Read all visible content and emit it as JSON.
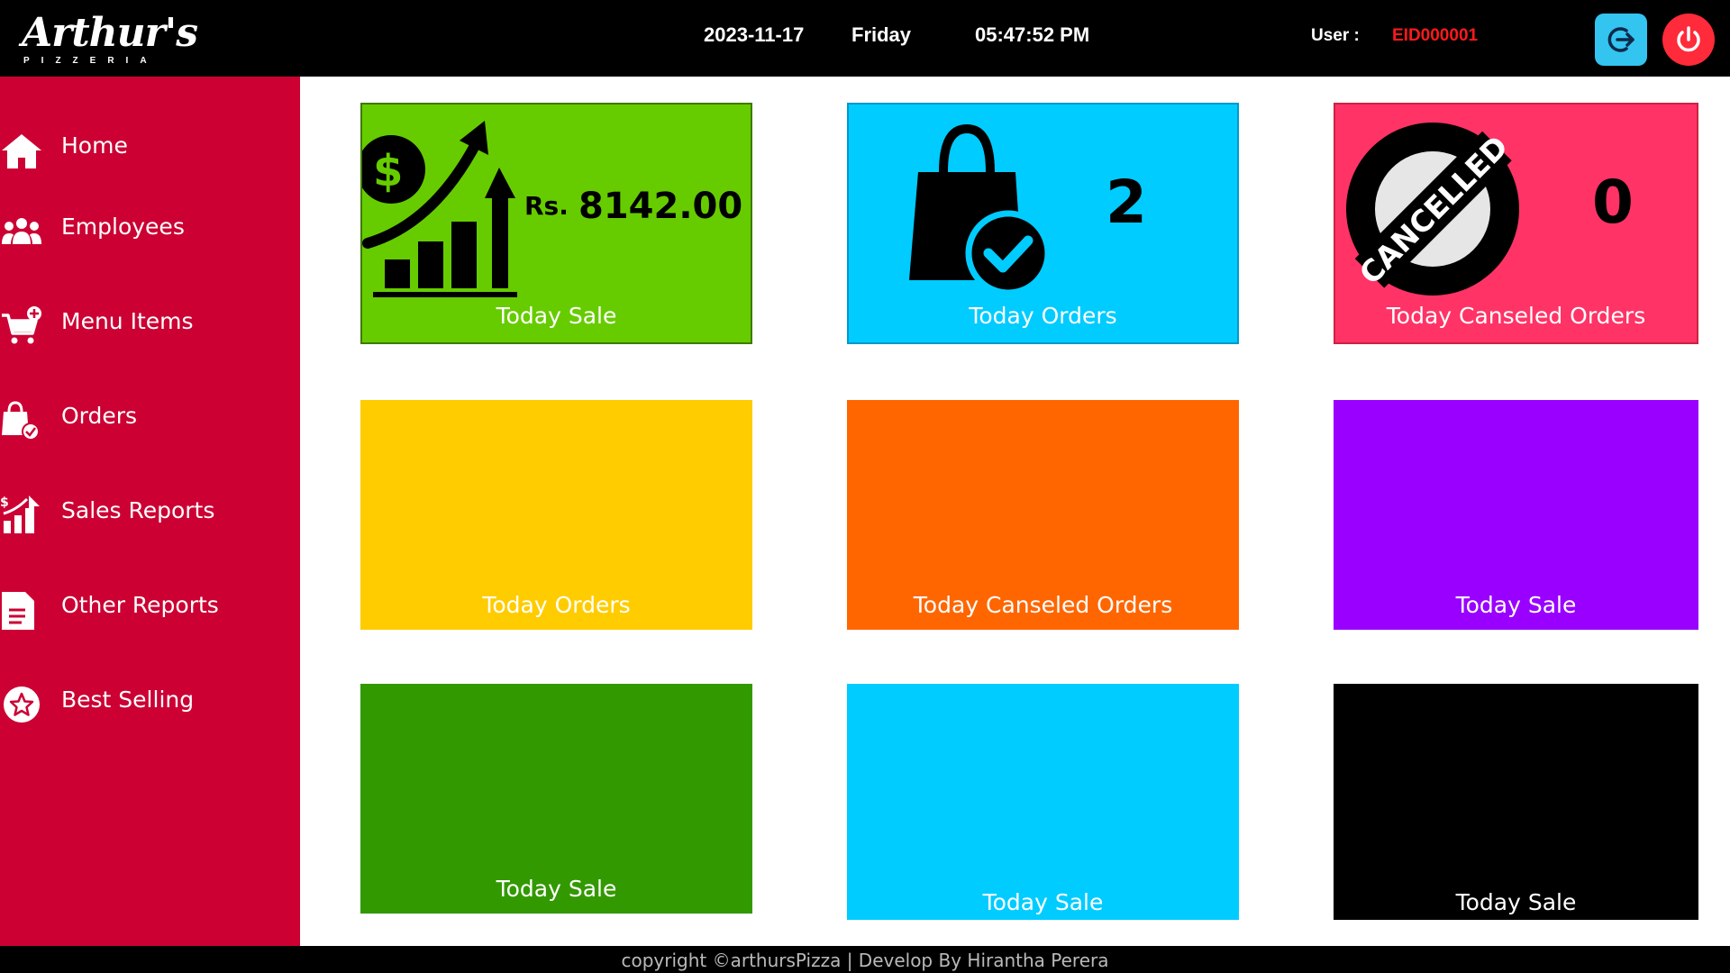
{
  "header": {
    "logo_main": "Arthur's",
    "logo_sub": "PIZZERIA",
    "date": "2023-11-17",
    "day": "Friday",
    "time": "05:47:52 PM",
    "user_label": "User :",
    "user_id": "EID000001"
  },
  "sidebar": {
    "items": [
      {
        "label": "Home",
        "icon": "home-icon"
      },
      {
        "label": "Employees",
        "icon": "employees-icon"
      },
      {
        "label": "Menu Items",
        "icon": "cart-add-icon"
      },
      {
        "label": "Orders",
        "icon": "shopping-bag-check-icon"
      },
      {
        "label": "Sales Reports",
        "icon": "bar-chart-dollar-icon"
      },
      {
        "label": "Other Reports",
        "icon": "document-icon"
      },
      {
        "label": "Best Selling",
        "icon": "star-badge-icon"
      }
    ]
  },
  "tiles": [
    {
      "caption": "Today Sale",
      "value_prefix": "Rs.",
      "value": "8142.00",
      "color": "#66cc00"
    },
    {
      "caption": "Today Orders",
      "value": "2",
      "color": "#00ccff"
    },
    {
      "caption": "Today Canseled Orders",
      "value": "0",
      "stamp_text": "CANCELLED",
      "color": "#ff3366"
    },
    {
      "caption": "Today Orders",
      "color": "#ffcc00"
    },
    {
      "caption": "Today Canseled Orders",
      "color": "#ff6600"
    },
    {
      "caption": "Today Sale",
      "color": "#9900ff"
    },
    {
      "caption": "Today Sale",
      "color": "#339900"
    },
    {
      "caption": "Today Sale",
      "color": "#00ccff"
    },
    {
      "caption": "Today Sale",
      "color": "#000000"
    }
  ],
  "footer": {
    "text": "copyright ©arthursPizza | Develop By Hirantha Perera"
  }
}
